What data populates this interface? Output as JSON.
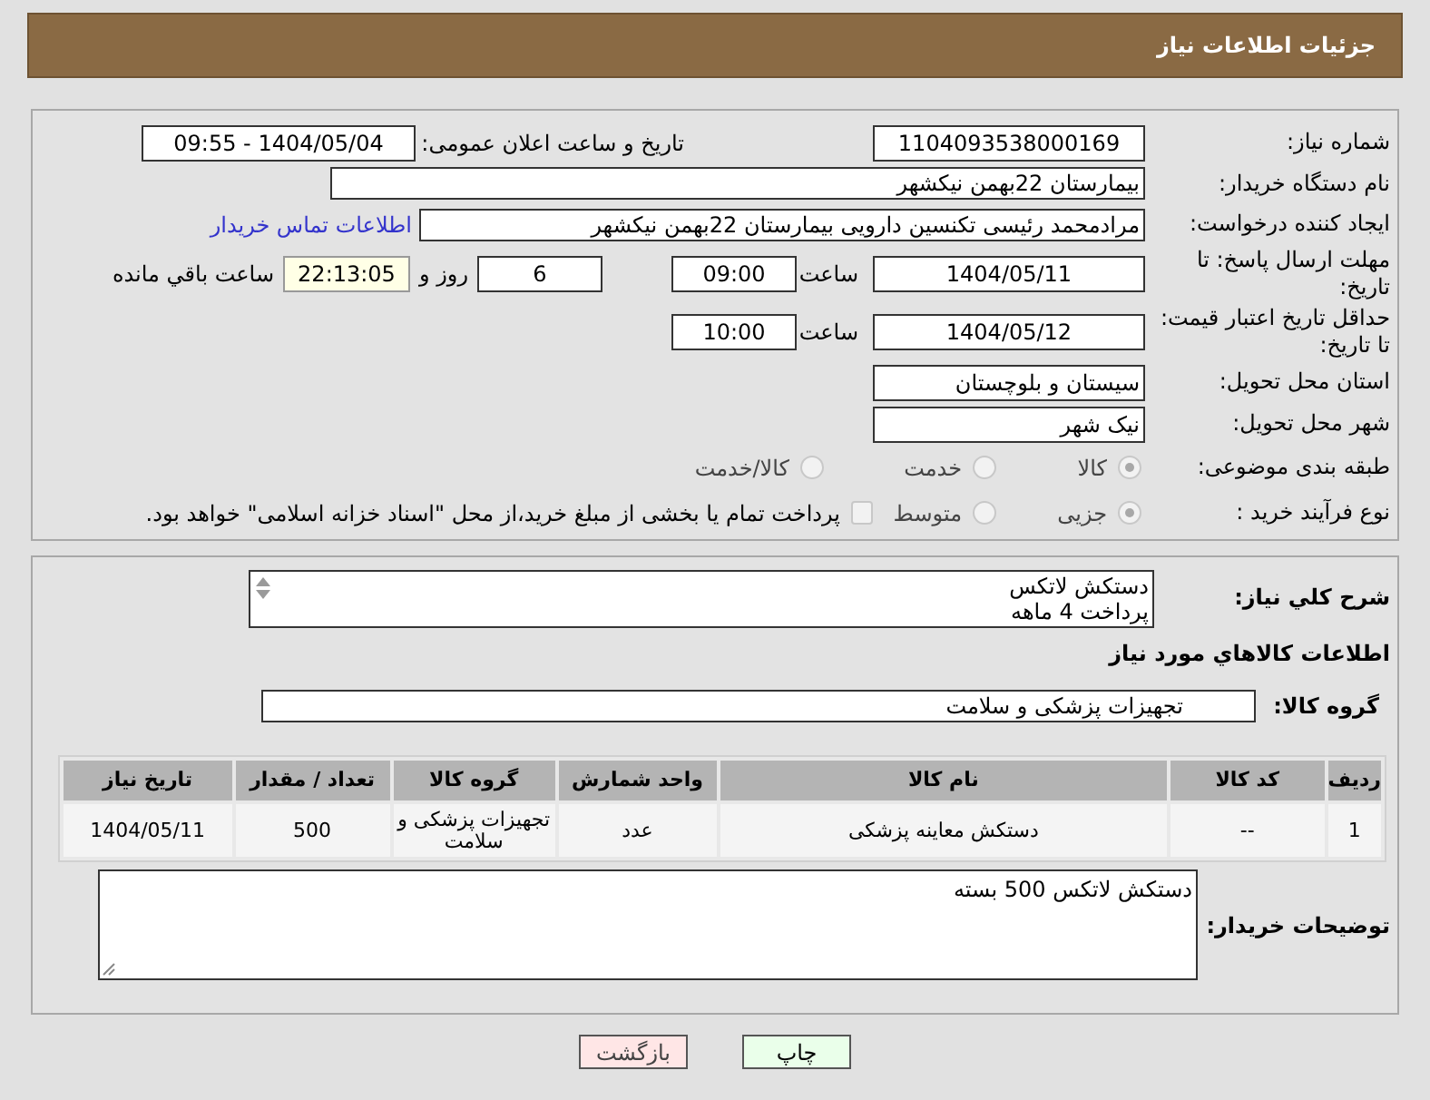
{
  "header": {
    "title": "جزئیات اطلاعات نیاز"
  },
  "need_number": {
    "label": "شماره نیاز:",
    "value": "1104093538000169"
  },
  "announce": {
    "label": "تاریخ و ساعت اعلان عمومی:",
    "value": "1404/05/04 - 09:55"
  },
  "buyer_org": {
    "label": "نام دستگاه خریدار:",
    "value": "بیمارستان 22بهمن نیکشهر"
  },
  "requester": {
    "label": "ایجاد کننده درخواست:",
    "value": "مرادمحمد رئیسی تکنسین دارویی بیمارستان 22بهمن نیکشهر",
    "link": "اطلاعات تماس خریدار"
  },
  "reply_deadline": {
    "label": "مهلت ارسال پاسخ: تا تاریخ:",
    "date": "1404/05/11",
    "time_label": "ساعت",
    "time": "09:00",
    "days": "6",
    "days_label": "روز و",
    "remaining": "22:13:05",
    "remaining_label": "ساعت باقي مانده"
  },
  "price_validity": {
    "label": "حداقل تاریخ اعتبار قیمت: تا تاریخ:",
    "date": "1404/05/12",
    "time_label": "ساعت",
    "time": "10:00"
  },
  "province": {
    "label": "استان محل تحویل:",
    "value": "سیستان و بلوچستان"
  },
  "city": {
    "label": "شهر محل تحویل:",
    "value": "نیک شهر"
  },
  "category": {
    "label": "طبقه بندی موضوعی:",
    "options": [
      {
        "label": "کالا",
        "selected": true
      },
      {
        "label": "خدمت",
        "selected": false
      },
      {
        "label": "کالا/خدمت",
        "selected": false
      }
    ]
  },
  "process": {
    "label": "نوع فرآیند خرید :",
    "options": [
      {
        "label": "جزیی",
        "selected": true
      },
      {
        "label": "متوسط",
        "selected": false
      }
    ],
    "treasury": {
      "label": "پرداخت تمام یا بخشی از مبلغ خرید،از محل \"اسناد خزانه اسلامی\" خواهد بود.",
      "checked": false
    }
  },
  "description": {
    "label": "شرح کلي نياز:",
    "lines": [
      "دستکش لاتکس",
      "پرداخت 4 ماهه"
    ]
  },
  "goods_heading": "اطلاعات کالاهاي مورد نياز",
  "goods_group": {
    "label": "گروه کالا:",
    "value": "تجهیزات پزشکی و سلامت"
  },
  "table": {
    "columns": [
      "ردیف",
      "کد کالا",
      "نام کالا",
      "واحد شمارش",
      "گروه کالا",
      "تعداد / مقدار",
      "تاریخ نیاز"
    ],
    "rows": [
      [
        "1",
        "--",
        "دستکش معاینه پزشکی",
        "عدد",
        "تجهیزات پزشکی و سلامت",
        "500",
        "1404/05/11"
      ]
    ]
  },
  "buyer_notes": {
    "label": "توضیحات خریدار:",
    "value": "دستکش لاتکس 500 بسته"
  },
  "buttons": [
    {
      "label": "چاپ",
      "kind": "print"
    },
    {
      "label": "بازگشت",
      "kind": "back"
    }
  ]
}
